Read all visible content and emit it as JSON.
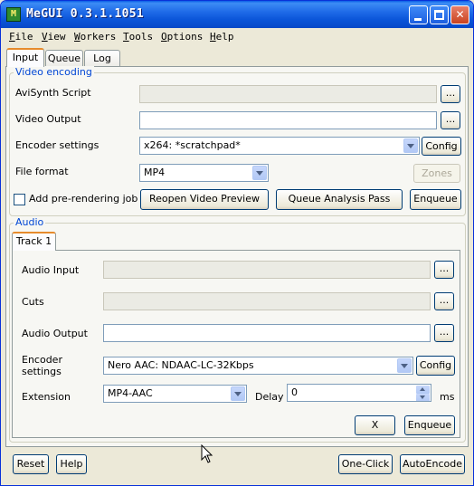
{
  "window": {
    "title": "MeGUI 0.3.1.1051",
    "icon": "megui-app-icon",
    "icon_glyph": "M"
  },
  "titlebar_buttons": {
    "minimize": "minimize-icon",
    "maximize": "maximize-icon",
    "close": "close-icon",
    "close_glyph": "✕"
  },
  "menu": [
    {
      "label": "File",
      "accel": "F",
      "rest": "ile"
    },
    {
      "label": "View",
      "accel": "V",
      "rest": "iew"
    },
    {
      "label": "Workers",
      "accel": "W",
      "rest": "orkers"
    },
    {
      "label": "Tools",
      "accel": "T",
      "rest": "ools"
    },
    {
      "label": "Options",
      "accel": "O",
      "rest": "ptions"
    },
    {
      "label": "Help",
      "accel": "H",
      "rest": "elp"
    }
  ],
  "tabs": [
    {
      "label": "Input",
      "active": true
    },
    {
      "label": "Queue",
      "active": false
    },
    {
      "label": "Log",
      "active": false
    }
  ],
  "video": {
    "group_title": "Video encoding",
    "avisynth_label": "AviSynth Script",
    "avisynth_value": "",
    "output_label": "Video Output",
    "output_value": "",
    "encoder_label": "Encoder settings",
    "encoder_value": "x264: *scratchpad*",
    "config_label": "Config",
    "format_label": "File format",
    "format_value": "MP4",
    "zones_label": "Zones",
    "prerender_label": "Add pre-rendering job",
    "prerender_checked": false,
    "reopen_label": "Reopen Video Preview",
    "analysis_label": "Queue Analysis Pass",
    "enqueue_label": "Enqueue",
    "browse_label": "..."
  },
  "audio": {
    "group_title": "Audio",
    "track_tab": "Track 1",
    "input_label": "Audio Input",
    "input_value": "",
    "cuts_label": "Cuts",
    "cuts_value": "",
    "output_label": "Audio Output",
    "output_value": "",
    "encoder_label_line1": "Encoder",
    "encoder_label_line2": "settings",
    "encoder_value": "Nero AAC: NDAAC-LC-32Kbps",
    "config_label": "Config",
    "extension_label": "Extension",
    "extension_value": "MP4-AAC",
    "delay_label": "Delay",
    "delay_value": "0",
    "delay_unit": "ms",
    "clear_label": "X",
    "enqueue_label": "Enqueue",
    "browse_label": "..."
  },
  "footer": {
    "reset_label": "Reset",
    "help_label": "Help",
    "oneclick_label": "One-Click",
    "autoencode_label": "AutoEncode"
  },
  "colors": {
    "accent_titlebar": "#0a54d8",
    "group_title": "#0046d5",
    "active_tab": "#e68b2c"
  }
}
